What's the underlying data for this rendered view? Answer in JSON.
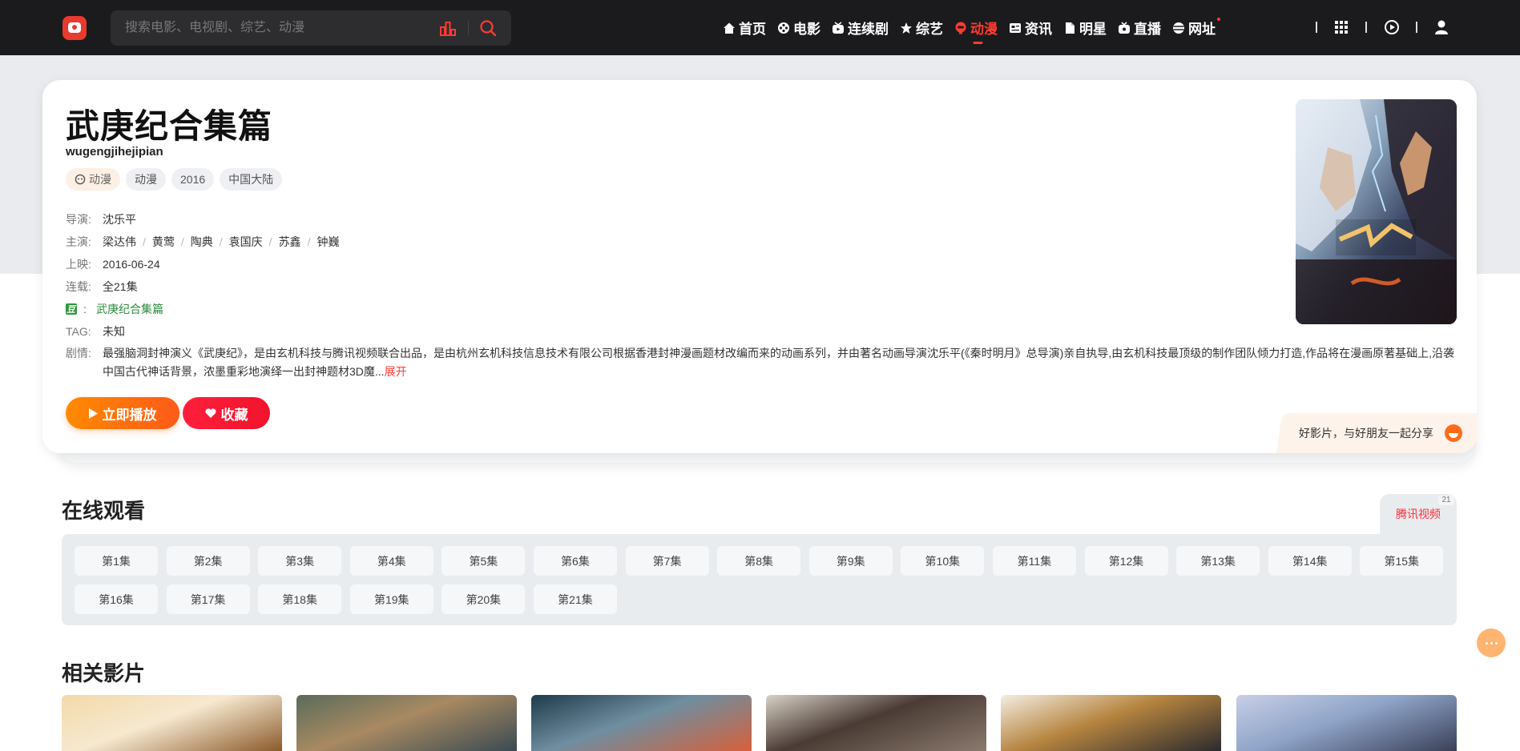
{
  "header": {
    "search_placeholder": "搜索电影、电视剧、综艺、动漫",
    "nav": [
      {
        "label": "首页",
        "icon": "home-icon",
        "active": false
      },
      {
        "label": "电影",
        "icon": "film-reel-icon",
        "active": false
      },
      {
        "label": "连续剧",
        "icon": "tv-icon",
        "active": false
      },
      {
        "label": "综艺",
        "icon": "star-icon",
        "active": false
      },
      {
        "label": "动漫",
        "icon": "anime-face-icon",
        "active": true
      },
      {
        "label": "资讯",
        "icon": "news-icon",
        "active": false
      },
      {
        "label": "明星",
        "icon": "document-icon",
        "active": false
      },
      {
        "label": "直播",
        "icon": "live-tv-icon",
        "active": false
      },
      {
        "label": "网址",
        "icon": "globe-icon",
        "active": false
      }
    ],
    "accent_color": "#ff3b30"
  },
  "detail": {
    "title": "武庚纪合集篇",
    "subtitle": "wugengjihejipian",
    "tags": [
      "动漫",
      "动漫",
      "2016",
      "中国大陆"
    ],
    "director_label": "导演:",
    "director": "沈乐平",
    "cast_label": "主演:",
    "cast": [
      "梁达伟",
      "黄莺",
      "陶典",
      "袁国庆",
      "苏鑫",
      "钟巍"
    ],
    "release_label": "上映:",
    "release": "2016-06-24",
    "episodes_label": "连载:",
    "episodes": "全21集",
    "douban_sep": ":",
    "douban_link": "武庚纪合集篇",
    "tag_label": "TAG:",
    "tag_value": "未知",
    "plot_label": "剧情:",
    "plot": "最强脑洞封神演义《武庚纪》，是由玄机科技与腾讯视频联合出品，是由杭州玄机科技信息技术有限公司根据香港封神漫画题材改编而来的动画系列，并由著名动画导演沈乐平(《秦时明月》总导演)亲自执导,由玄机科技最顶级的制作团队倾力打造,作品将在漫画原著基础上,沿袭中国古代神话背景，浓墨重彩地演绎一出封神题材3D魔...",
    "plot_more": "展开",
    "play_label": "立即播放",
    "fav_label": "收藏",
    "share_text": "好影片，与好朋友一起分享"
  },
  "playlist": {
    "section_title": "在线观看",
    "source_name": "腾讯视频",
    "source_count": "21",
    "episodes": [
      "第1集",
      "第2集",
      "第3集",
      "第4集",
      "第5集",
      "第6集",
      "第7集",
      "第8集",
      "第9集",
      "第10集",
      "第11集",
      "第12集",
      "第13集",
      "第14集",
      "第15集",
      "第16集",
      "第17集",
      "第18集",
      "第19集",
      "第20集",
      "第21集"
    ]
  },
  "related": {
    "section_title": "相关影片",
    "count": 6
  }
}
